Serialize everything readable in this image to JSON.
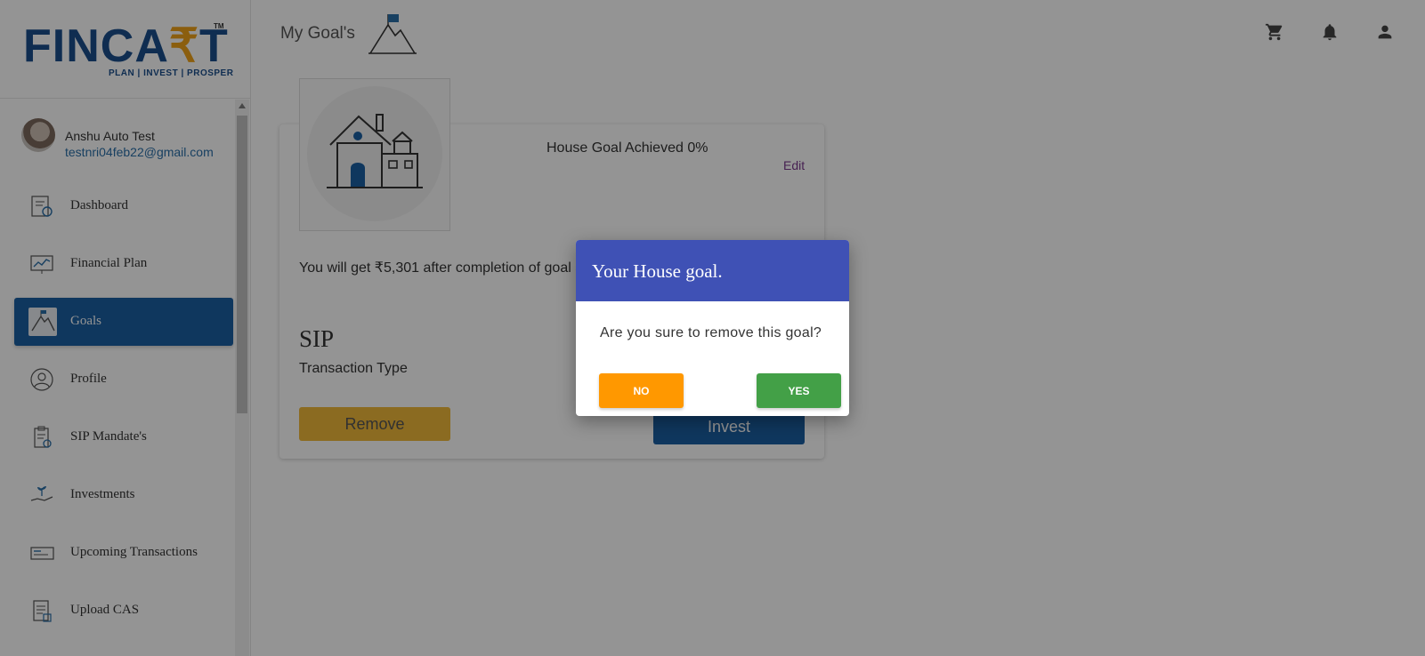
{
  "brand": {
    "logo_text_a": "FINCA",
    "logo_rupee": "₹",
    "logo_text_b": "T",
    "tagline": "PLAN | INVEST | PROSPER",
    "tm": "TM",
    "color": "#1b4f8c",
    "accent": "#f0a319"
  },
  "user": {
    "name": "Anshu Auto Test",
    "email": "testnri04feb22@gmail.com"
  },
  "sidebar": {
    "items": [
      {
        "label": "Dashboard",
        "icon": "dashboard-icon"
      },
      {
        "label": "Financial Plan",
        "icon": "chart-icon"
      },
      {
        "label": "Goals",
        "icon": "goals-icon",
        "active": true
      },
      {
        "label": "Profile",
        "icon": "profile-icon"
      },
      {
        "label": "SIP Mandate's",
        "icon": "clipboard-icon"
      },
      {
        "label": "Investments",
        "icon": "invest-hand-icon"
      },
      {
        "label": "Upcoming Transactions",
        "icon": "cheque-icon"
      },
      {
        "label": "Upload CAS",
        "icon": "document-icon"
      }
    ],
    "active_color": "#1b5fa3"
  },
  "header": {
    "title": "My Goal's",
    "icons": [
      "cart-icon",
      "bell-icon",
      "account-icon"
    ]
  },
  "goal_card": {
    "achieved_text": "House Goal Achieved 0%",
    "edit_label": "Edit",
    "description": "You will get ₹5,301 after completion of goal and time for the goal is 1 Years",
    "plan_type": "SIP",
    "plan_type_label": "Transaction Type",
    "remove_label": "Remove",
    "invest_label": "Invest"
  },
  "dialog": {
    "title": "Your House goal.",
    "message": "Are you sure to remove this goal?",
    "no_label": "NO",
    "yes_label": "YES",
    "header_color": "#3f51b5",
    "no_color": "#ff9800",
    "yes_color": "#43a047"
  }
}
